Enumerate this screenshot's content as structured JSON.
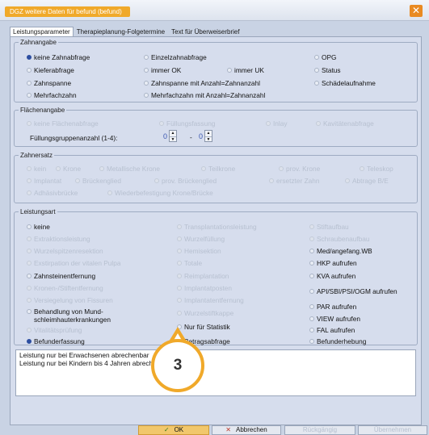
{
  "window": {
    "title": "DGZ weitere Daten für befund (befund)",
    "close": "✕"
  },
  "tabs": [
    {
      "label": "Leistungsparameter"
    },
    {
      "label": "Therapieplanung-Folgetermine"
    },
    {
      "label": "Text für Überweiserbrief"
    }
  ],
  "zahnangabe": {
    "legend": "Zahnangabe",
    "items": [
      {
        "label": "keine Zahnabfrage",
        "checked": true
      },
      {
        "label": "Einzelzahnabfrage"
      },
      {
        "label": "OPG"
      },
      {
        "label": "Kieferabfrage"
      },
      {
        "label": "immer OK"
      },
      {
        "label": "immer UK"
      },
      {
        "label": "Status"
      },
      {
        "label": "Zahnspanne"
      },
      {
        "label": "Zahnspanne mit Anzahl=Zahnanzahl"
      },
      {
        "label": "Schädelaufnahme"
      },
      {
        "label": "Mehrfachzahn"
      },
      {
        "label": "Mehrfachzahn mit Anzahl=Zahnanzahl"
      }
    ]
  },
  "flaechenangabe": {
    "legend": "Flächenangabe",
    "items": [
      {
        "label": "keine Flächenabfrage"
      },
      {
        "label": "Füllungsfassung"
      },
      {
        "label": "Inlay"
      },
      {
        "label": "Kavitätenabfrage"
      }
    ],
    "fuellung_label": "Füllungsgruppenanzahl (1-4):",
    "spin_from": "0",
    "spin_to": "0",
    "dash": "-"
  },
  "zahnersatz": {
    "legend": "Zahnersatz",
    "items": [
      {
        "label": "kein"
      },
      {
        "label": "Krone"
      },
      {
        "label": "Metallische Krone"
      },
      {
        "label": "Teilkrone"
      },
      {
        "label": "prov. Krone"
      },
      {
        "label": "Teleskop"
      },
      {
        "label": "Implantat"
      },
      {
        "label": "Brückenglied"
      },
      {
        "label": "prov. Brückenglied"
      },
      {
        "label": "ersetzter Zahn"
      },
      {
        "label": "Abtrage B/E"
      },
      {
        "label": "Adhäsivbrücke"
      },
      {
        "label": "Wiederbefestigung Krone/Brücke"
      }
    ]
  },
  "leistungsart": {
    "legend": "Leistungsart",
    "col1": [
      {
        "label": "keine",
        "enabled": true
      },
      {
        "label": "Extraktionsleistung"
      },
      {
        "label": "Wurzelspitzenresektion"
      },
      {
        "label": "Exstirpation der vitalen Pulpa"
      },
      {
        "label": "Zahnsteinentfernung",
        "enabled": true
      },
      {
        "label": "Kronen-/Stiftentfernung"
      },
      {
        "label": "Versiegelung von Fissuren"
      },
      {
        "label": "Behandlung von Mund-\nschleimhauterkrankungen",
        "enabled": true
      },
      {
        "label": "Vitalitätsprüfung"
      },
      {
        "label": "Befunderfassung",
        "enabled": true,
        "checked": true
      }
    ],
    "col2": [
      {
        "label": "Transplantationsleistung"
      },
      {
        "label": "Wurzelfüllung"
      },
      {
        "label": "Hemisektion"
      },
      {
        "label": "Totale"
      },
      {
        "label": "Reimplantation"
      },
      {
        "label": "Implantatposten"
      },
      {
        "label": "Implantatentfernung"
      },
      {
        "label": "Wurzelstiftkappe"
      },
      {
        "label": "Nur für Statistik",
        "enabled": true
      },
      {
        "label": "Betragsabfrage",
        "enabled": true
      }
    ],
    "col3": [
      {
        "label": "Stiftaufbau"
      },
      {
        "label": "Schraubenaufbau"
      },
      {
        "label": "Med/angefang.WB",
        "enabled": true
      },
      {
        "label": "HKP aufrufen",
        "enabled": true
      },
      {
        "label": "KVA aufrufen",
        "enabled": true
      },
      {
        "label": "API/SBI/PSI/OGM aufrufen",
        "enabled": true
      },
      {
        "label": "PAR aufrufen",
        "enabled": true
      },
      {
        "label": "VIEW aufrufen",
        "enabled": true
      },
      {
        "label": "FAL aufrufen",
        "enabled": true
      },
      {
        "label": "Befunderhebung",
        "enabled": true
      }
    ]
  },
  "notes": {
    "line1": "Leistung nur bei Erwachsenen abrechenbar",
    "line2": "Leistung nur bei Kindern bis 4 Jahren abrechenbar"
  },
  "buttons": {
    "ok": "OK",
    "ok_icon": "✓",
    "cancel": "Abbrechen",
    "cancel_icon": "✕",
    "back": "Rückgängig",
    "apply": "Übernehmen"
  },
  "badge": {
    "number": "3"
  },
  "colors": {
    "accent": "#f0a92a",
    "selected": "#2d4ea0",
    "panel": "#d6dded"
  }
}
